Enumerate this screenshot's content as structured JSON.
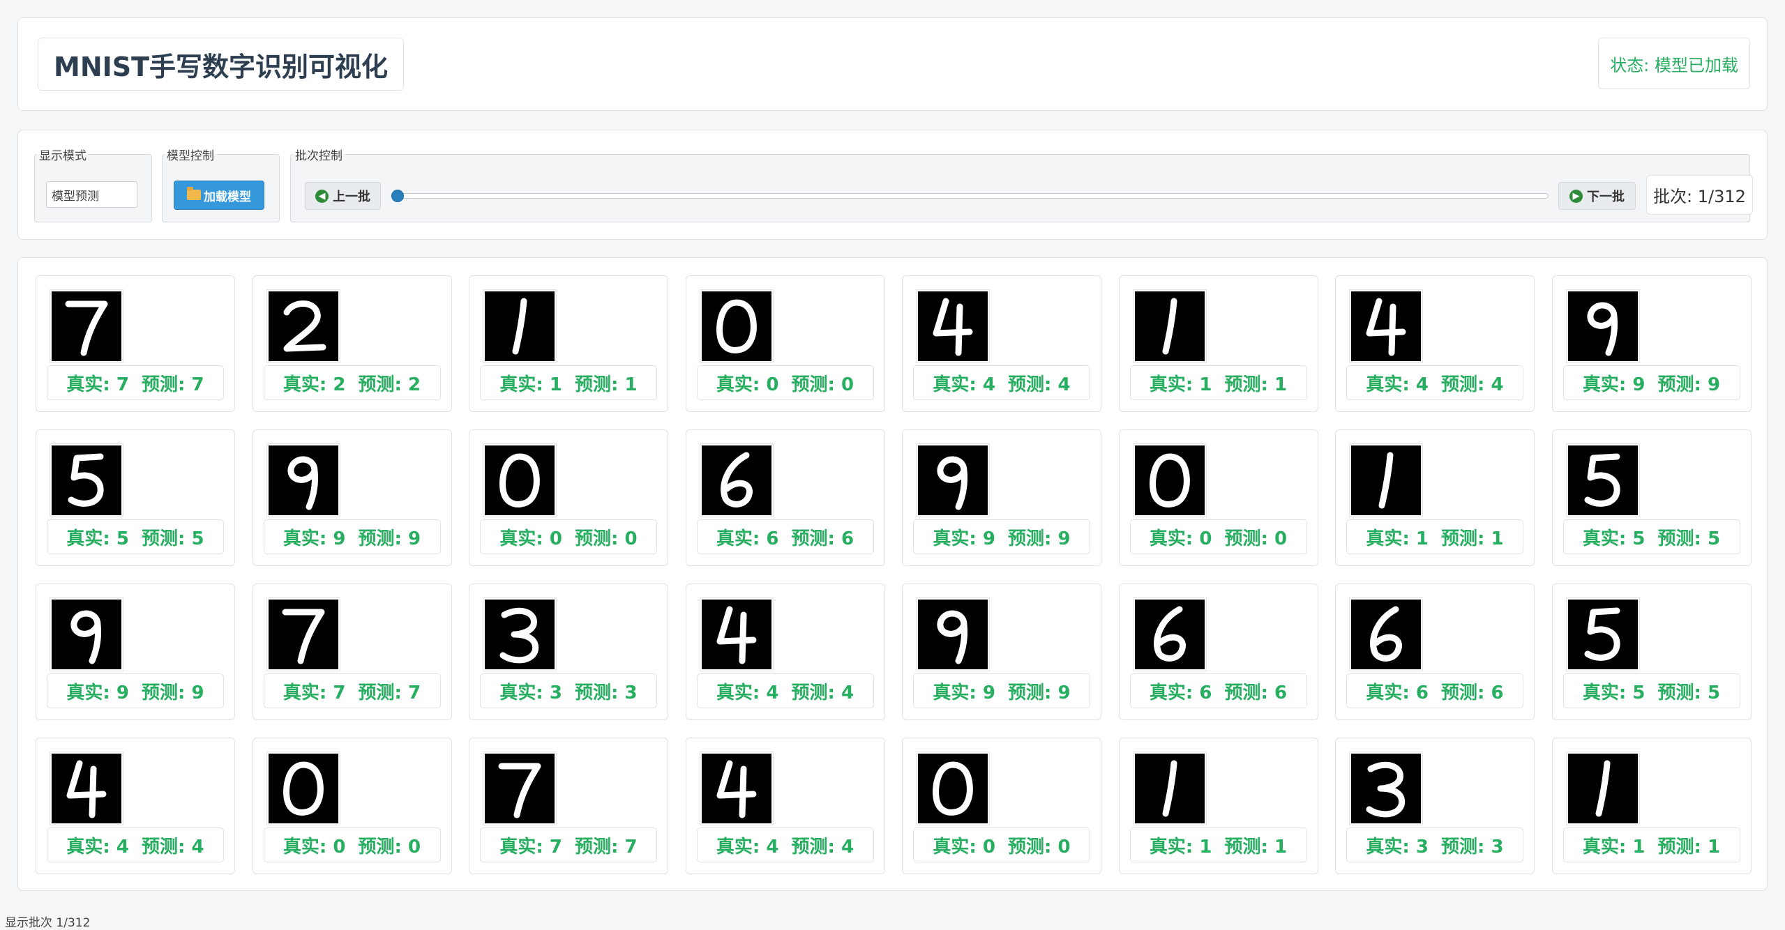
{
  "app": {
    "title": "MNIST手写数字识别可视化",
    "status": "状态: 模型已加载"
  },
  "controls": {
    "display_mode": {
      "legend": "显示模式",
      "value": "模型预测"
    },
    "model_control": {
      "legend": "模型控制",
      "load_label": "加载模型",
      "icon": "folder-icon"
    },
    "batch_control": {
      "legend": "批次控制",
      "prev_label": "上一批",
      "next_label": "下一批",
      "current_batch": 1,
      "total_batches": 312,
      "counter": "批次: 1/312"
    }
  },
  "samples": [
    {
      "label": "真实: 7  预测: 7",
      "digit": 7
    },
    {
      "label": "真实: 2  预测: 2",
      "digit": 2
    },
    {
      "label": "真实: 1  预测: 1",
      "digit": 1
    },
    {
      "label": "真实: 0  预测: 0",
      "digit": 0
    },
    {
      "label": "真实: 4  预测: 4",
      "digit": 4
    },
    {
      "label": "真实: 1  预测: 1",
      "digit": 1
    },
    {
      "label": "真实: 4  预测: 4",
      "digit": 4
    },
    {
      "label": "真实: 9  预测: 9",
      "digit": 9
    },
    {
      "label": "真实: 5  预测: 5",
      "digit": 5
    },
    {
      "label": "真实: 9  预测: 9",
      "digit": 9
    },
    {
      "label": "真实: 0  预测: 0",
      "digit": 0
    },
    {
      "label": "真实: 6  预测: 6",
      "digit": 6
    },
    {
      "label": "真实: 9  预测: 9",
      "digit": 9
    },
    {
      "label": "真实: 0  预测: 0",
      "digit": 0
    },
    {
      "label": "真实: 1  预测: 1",
      "digit": 1
    },
    {
      "label": "真实: 5  预测: 5",
      "digit": 5
    },
    {
      "label": "真实: 9  预测: 9",
      "digit": 9
    },
    {
      "label": "真实: 7  预测: 7",
      "digit": 7
    },
    {
      "label": "真实: 3  预测: 3",
      "digit": 3
    },
    {
      "label": "真实: 4  预测: 4",
      "digit": 4
    },
    {
      "label": "真实: 9  预测: 9",
      "digit": 9
    },
    {
      "label": "真实: 6  预测: 6",
      "digit": 6
    },
    {
      "label": "真实: 6  预测: 6",
      "digit": 6
    },
    {
      "label": "真实: 5  预测: 5",
      "digit": 5
    },
    {
      "label": "真实: 4  预测: 4",
      "digit": 4
    },
    {
      "label": "真实: 0  预测: 0",
      "digit": 0
    },
    {
      "label": "真实: 7  预测: 7",
      "digit": 7
    },
    {
      "label": "真实: 4  预测: 4",
      "digit": 4
    },
    {
      "label": "真实: 0  预测: 0",
      "digit": 0
    },
    {
      "label": "真实: 1  预测: 1",
      "digit": 1
    },
    {
      "label": "真实: 3  预测: 3",
      "digit": 3
    },
    {
      "label": "真实: 1  预测: 1",
      "digit": 1
    }
  ],
  "footer": {
    "text": "显示批次 1/312"
  }
}
